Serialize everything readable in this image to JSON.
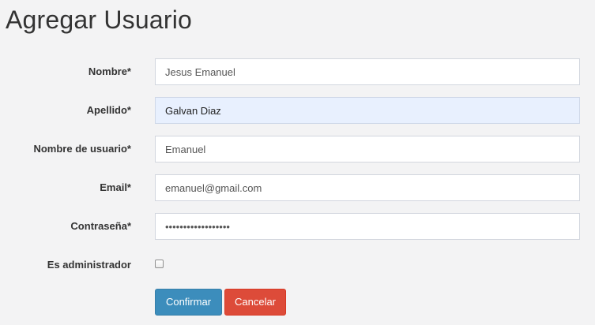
{
  "page": {
    "title": "Agregar Usuario"
  },
  "form": {
    "fields": [
      {
        "label": "Nombre*",
        "value": "Jesus Emanuel",
        "type": "text"
      },
      {
        "label": "Apellido*",
        "value": "Galvan Diaz",
        "type": "text"
      },
      {
        "label": "Nombre de usuario*",
        "value": "Emanuel",
        "type": "text"
      },
      {
        "label": "Email*",
        "value": "emanuel@gmail.com",
        "type": "email"
      },
      {
        "label": "Contraseña*",
        "value": "••••••••••••••••••",
        "type": "password"
      }
    ],
    "admin": {
      "label": "Es administrador",
      "checked": false
    },
    "buttons": {
      "confirm": "Confirmar",
      "cancel": "Cancelar"
    }
  },
  "colors": {
    "primary": "#3c8dbc",
    "danger": "#dd4b39",
    "autofill": "#e8f0fe",
    "background": "#f3f3f4"
  }
}
